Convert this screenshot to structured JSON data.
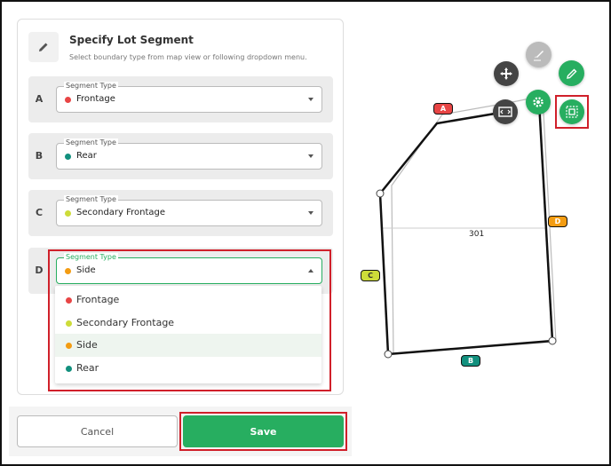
{
  "panel": {
    "title": "Specify Lot Segment",
    "subtitle": "Select boundary type from map view or following dropdown menu."
  },
  "segments": [
    {
      "letter": "A",
      "field_label": "Segment Type",
      "value": "Frontage",
      "color": "#e84545"
    },
    {
      "letter": "B",
      "field_label": "Segment Type",
      "value": "Rear",
      "color": "#12907e"
    },
    {
      "letter": "C",
      "field_label": "Segment Type",
      "value": "Secondary Frontage",
      "color": "#cddc39"
    },
    {
      "letter": "D",
      "field_label": "Segment Type",
      "value": "Side",
      "color": "#f39c12"
    }
  ],
  "dropdown": {
    "options": [
      {
        "label": "Frontage",
        "color": "#e84545"
      },
      {
        "label": "Secondary Frontage",
        "color": "#cddc39"
      },
      {
        "label": "Side",
        "color": "#f39c12",
        "selected": true
      },
      {
        "label": "Rear",
        "color": "#12907e"
      }
    ]
  },
  "buttons": {
    "cancel": "Cancel",
    "save": "Save"
  },
  "map": {
    "area_label": "301",
    "edge_badges": [
      {
        "letter": "A",
        "color": "#e84545"
      },
      {
        "letter": "B",
        "color": "#12907e"
      },
      {
        "letter": "C",
        "color": "#cddc39"
      },
      {
        "letter": "D",
        "color": "#f39c12"
      }
    ],
    "tools": {
      "move": "move-icon",
      "pan": "pan-icon",
      "settings": "settings-gear-icon",
      "brush": "brush-icon",
      "edit": "edit-pencil-icon",
      "select_area": "select-area-icon"
    }
  },
  "colors": {
    "accent": "#27ae60",
    "highlight": "#d0202a"
  }
}
